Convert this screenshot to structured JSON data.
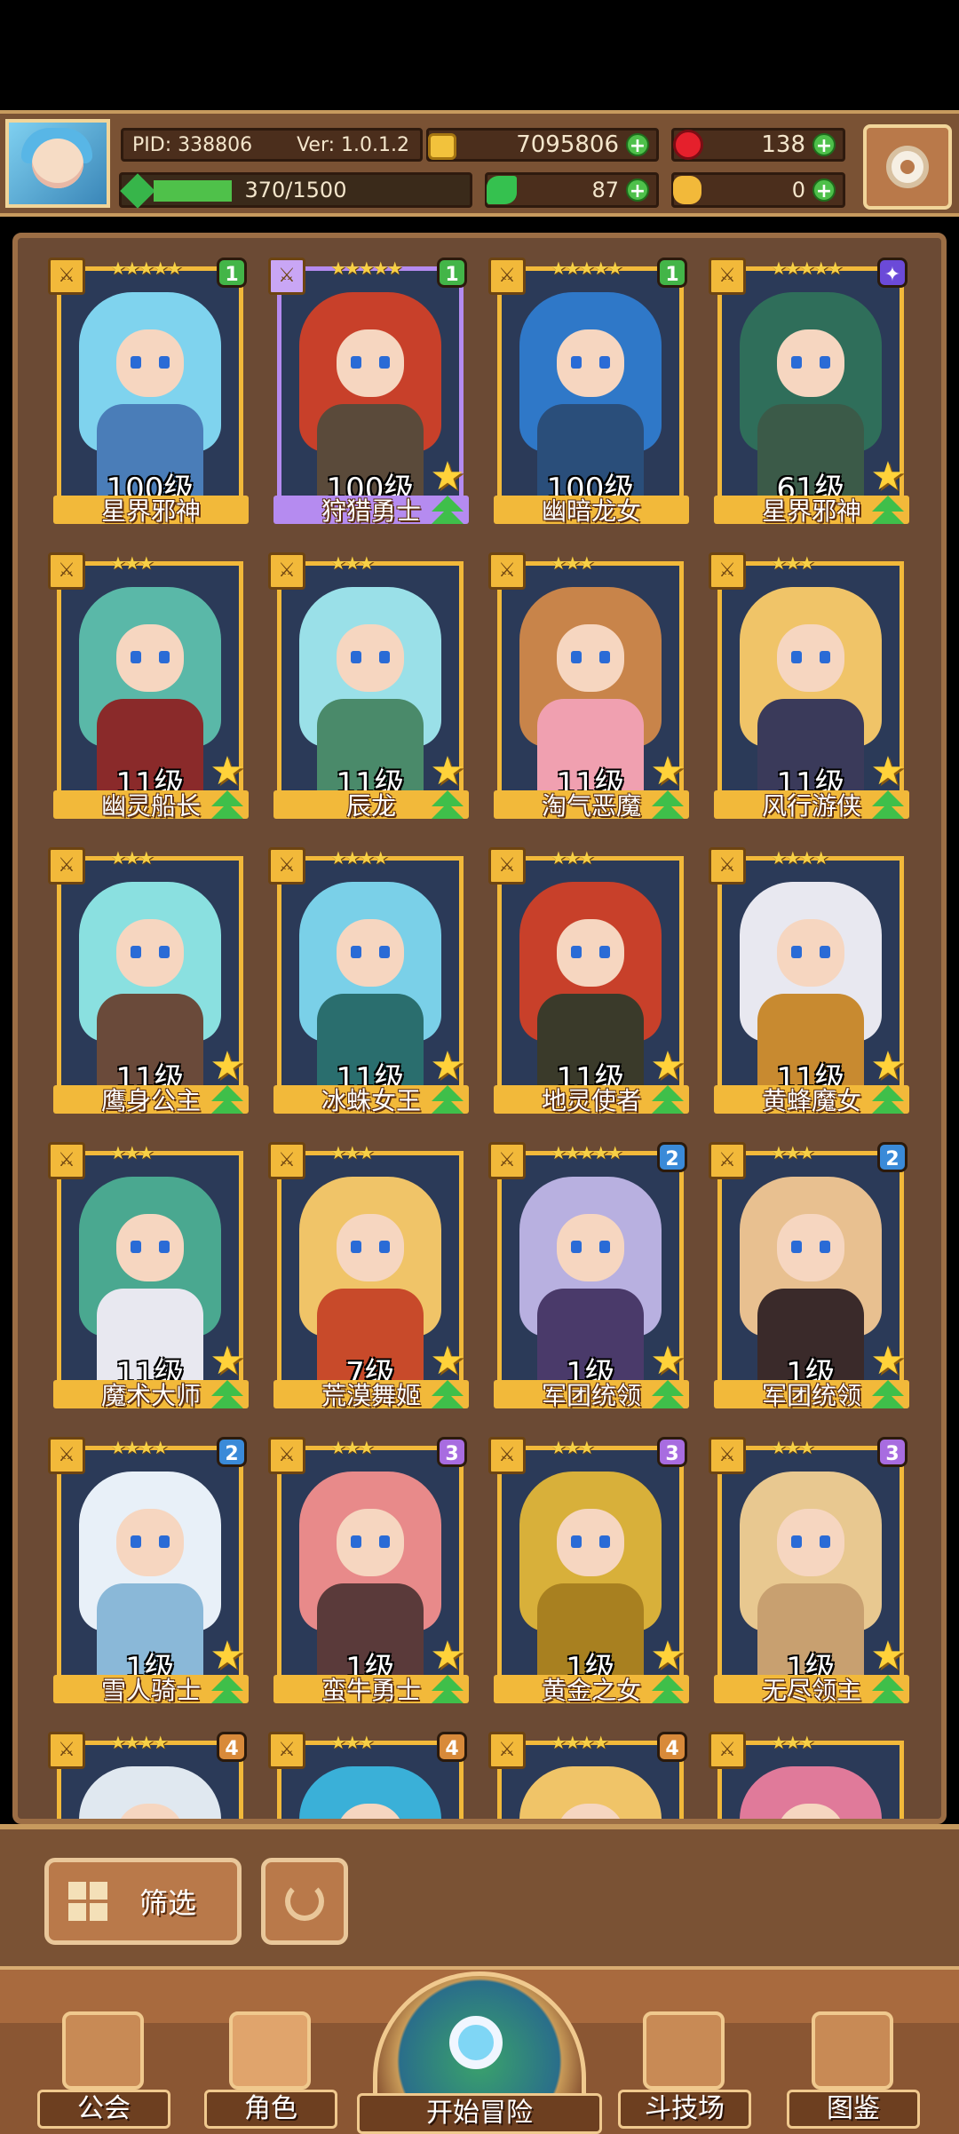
{
  "header": {
    "pid": "PID: 338806",
    "version": "Ver: 1.0.1.2",
    "gold": "7095806",
    "rubies": "138",
    "xp_text": "370/1500",
    "xp_fraction": 0.2467,
    "clovers": "87",
    "potions": "0"
  },
  "cards": [
    {
      "name": "星界邪神",
      "level": "100级",
      "stars": "★★★★★",
      "badge": "1",
      "badge_class": "b1",
      "frame": "gold",
      "hair": "#7fd3ee",
      "body": "#4a7db8",
      "rank": false
    },
    {
      "name": "狩猎勇士",
      "level": "100级",
      "stars": "★★★★★",
      "badge": "1",
      "badge_class": "b1",
      "frame": "purple",
      "hair": "#c8402a",
      "body": "#5a4a3a",
      "rank": true
    },
    {
      "name": "幽暗龙女",
      "level": "100级",
      "stars": "★★★★★",
      "badge": "1",
      "badge_class": "b1",
      "frame": "gold",
      "hair": "#2f78c8",
      "body": "#2a4e7a",
      "rank": false
    },
    {
      "name": "星界邪神",
      "level": "61级",
      "stars": "★★★★★",
      "badge": "✦",
      "badge_class": "bx",
      "frame": "gold",
      "hair": "#2f6e5a",
      "body": "#3b5a48",
      "rank": true
    },
    {
      "name": "幽灵船长",
      "level": "11级",
      "stars": "★★★",
      "badge": "",
      "badge_class": "",
      "frame": "gold",
      "hair": "#5ab8a8",
      "body": "#8a2a2a",
      "rank": true
    },
    {
      "name": "辰龙",
      "level": "11级",
      "stars": "★★★",
      "badge": "",
      "badge_class": "",
      "frame": "gold",
      "hair": "#9ae0e8",
      "body": "#4a8a6a",
      "rank": true
    },
    {
      "name": "淘气恶魔",
      "level": "11级",
      "stars": "★★★",
      "badge": "",
      "badge_class": "",
      "frame": "gold",
      "hair": "#c8844a",
      "body": "#f0a0b0",
      "rank": true
    },
    {
      "name": "风行游侠",
      "level": "11级",
      "stars": "★★★",
      "badge": "",
      "badge_class": "",
      "frame": "gold",
      "hair": "#f0c468",
      "body": "#3a3a5a",
      "rank": true
    },
    {
      "name": "鹰身公主",
      "level": "11级",
      "stars": "★★★",
      "badge": "",
      "badge_class": "",
      "frame": "gold",
      "hair": "#8ae0e0",
      "body": "#6a4a3a",
      "rank": true
    },
    {
      "name": "冰蛛女王",
      "level": "11级",
      "stars": "★★★★",
      "badge": "",
      "badge_class": "",
      "frame": "gold",
      "hair": "#7ad0e8",
      "body": "#2a6e6e",
      "rank": true
    },
    {
      "name": "地灵使者",
      "level": "11级",
      "stars": "★★★",
      "badge": "",
      "badge_class": "",
      "frame": "gold",
      "hair": "#c8402a",
      "body": "#3a3a2a",
      "rank": true
    },
    {
      "name": "黄蜂魔女",
      "level": "11级",
      "stars": "★★★★",
      "badge": "",
      "badge_class": "",
      "frame": "gold",
      "hair": "#e8e8f0",
      "body": "#c88a30",
      "rank": true
    },
    {
      "name": "魔术大师",
      "level": "11级",
      "stars": "★★★",
      "badge": "",
      "badge_class": "",
      "frame": "gold",
      "hair": "#4aa890",
      "body": "#e8e8f0",
      "rank": true
    },
    {
      "name": "荒漠舞姬",
      "level": "7级",
      "stars": "★★★",
      "badge": "",
      "badge_class": "",
      "frame": "gold",
      "hair": "#f0c468",
      "body": "#c84a2a",
      "rank": true
    },
    {
      "name": "军团统领",
      "level": "1级",
      "stars": "★★★★★",
      "badge": "2",
      "badge_class": "b2",
      "frame": "gold",
      "hair": "#b8b0e0",
      "body": "#4a3a6a",
      "rank": true
    },
    {
      "name": "军团统领",
      "level": "1级",
      "stars": "★★★",
      "badge": "2",
      "badge_class": "b2",
      "frame": "gold",
      "hair": "#e8c090",
      "body": "#3a2a2a",
      "rank": true
    },
    {
      "name": "雪人骑士",
      "level": "1级",
      "stars": "★★★★",
      "badge": "2",
      "badge_class": "b2",
      "frame": "gold",
      "hair": "#e8f0f8",
      "body": "#8ab8d8",
      "rank": true
    },
    {
      "name": "蛮牛勇士",
      "level": "1级",
      "stars": "★★★",
      "badge": "3",
      "badge_class": "b3",
      "frame": "gold",
      "hair": "#e88a8a",
      "body": "#5a3a3a",
      "rank": true
    },
    {
      "name": "黄金之女",
      "level": "1级",
      "stars": "★★★",
      "badge": "3",
      "badge_class": "b3",
      "frame": "gold",
      "hair": "#d8b03a",
      "body": "#a88020",
      "rank": true
    },
    {
      "name": "无尽领主",
      "level": "1级",
      "stars": "★★★",
      "badge": "3",
      "badge_class": "b3",
      "frame": "gold",
      "hair": "#e8c890",
      "body": "#c8a070",
      "rank": true
    },
    {
      "name": "",
      "level": "",
      "stars": "★★★★",
      "badge": "4",
      "badge_class": "b4",
      "frame": "gold",
      "hair": "#e0e8f0",
      "body": "#2b3a58",
      "rank": false
    },
    {
      "name": "",
      "level": "",
      "stars": "★★★",
      "badge": "4",
      "badge_class": "b4",
      "frame": "gold",
      "hair": "#3ab0d8",
      "body": "#2b3a58",
      "rank": false
    },
    {
      "name": "",
      "level": "",
      "stars": "★★★★",
      "badge": "4",
      "badge_class": "b4",
      "frame": "gold",
      "hair": "#f0c468",
      "body": "#2b3a58",
      "rank": false
    },
    {
      "name": "",
      "level": "",
      "stars": "★★★",
      "badge": "",
      "badge_class": "",
      "frame": "gold",
      "hair": "#e07a9a",
      "body": "#2b3a58",
      "rank": false
    }
  ],
  "filter": {
    "label": "筛选"
  },
  "nav": [
    {
      "label": "公会",
      "icon": "guild-icon"
    },
    {
      "label": "角色",
      "icon": "character-icon"
    },
    {
      "label": "开始冒险",
      "icon": "adventure-icon"
    },
    {
      "label": "斗技场",
      "icon": "arena-icon"
    },
    {
      "label": "图鉴",
      "icon": "codex-icon"
    }
  ]
}
